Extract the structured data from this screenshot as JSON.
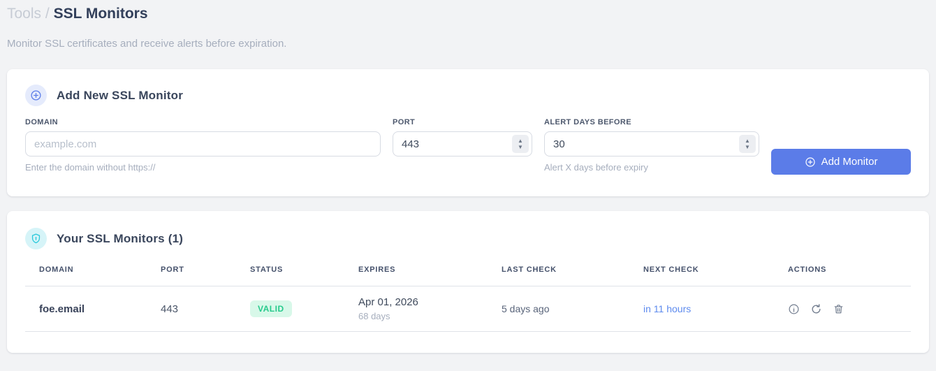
{
  "page": {
    "breadcrumb": {
      "parent": "Tools",
      "separator": "/",
      "current": "SSL Monitors"
    },
    "subtitle": "Monitor SSL certificates and receive alerts before expiration."
  },
  "add_monitor_card": {
    "title": "Add New SSL Monitor",
    "fields": {
      "domain": {
        "label": "DOMAIN",
        "placeholder": "example.com",
        "value": "",
        "helper": "Enter the domain without https://"
      },
      "port": {
        "label": "PORT",
        "value": "443"
      },
      "alert_days": {
        "label": "ALERT DAYS BEFORE",
        "value": "30",
        "helper": "Alert X days before expiry"
      }
    },
    "submit_label": "Add Monitor"
  },
  "monitors_card": {
    "title": "Your SSL Monitors (1)",
    "count": 1,
    "table": {
      "headers": [
        "DOMAIN",
        "PORT",
        "STATUS",
        "EXPIRES",
        "LAST CHECK",
        "NEXT CHECK",
        "ACTIONS"
      ],
      "rows": [
        {
          "domain": "foe.email",
          "port": "443",
          "status": "VALID",
          "expires_date": "Apr 01, 2026",
          "expires_days": "68 days",
          "last_check": "5 days ago",
          "next_check": "in 11 hours"
        }
      ]
    }
  },
  "icons": {
    "add_badge": "plus-circle-icon",
    "monitors_badge": "shield-icon",
    "button": "plus-circle-icon",
    "row_actions": [
      "info-icon",
      "refresh-icon",
      "trash-icon"
    ],
    "number_spinner": "chevron-up-down-icon"
  },
  "colors": {
    "background": "#f2f3f5",
    "card": "#ffffff",
    "accent_blue": "#5b7ce8",
    "accent_blue_bg": "#e5ebfc",
    "cyan": "#27c8da",
    "cyan_bg": "#d6f4f8",
    "valid_text": "#27ca8c",
    "valid_bg": "#d8f8e9",
    "next_check_link": "#5e8bee",
    "title_dark": "#33405b",
    "muted_text": "#a6aebd"
  }
}
